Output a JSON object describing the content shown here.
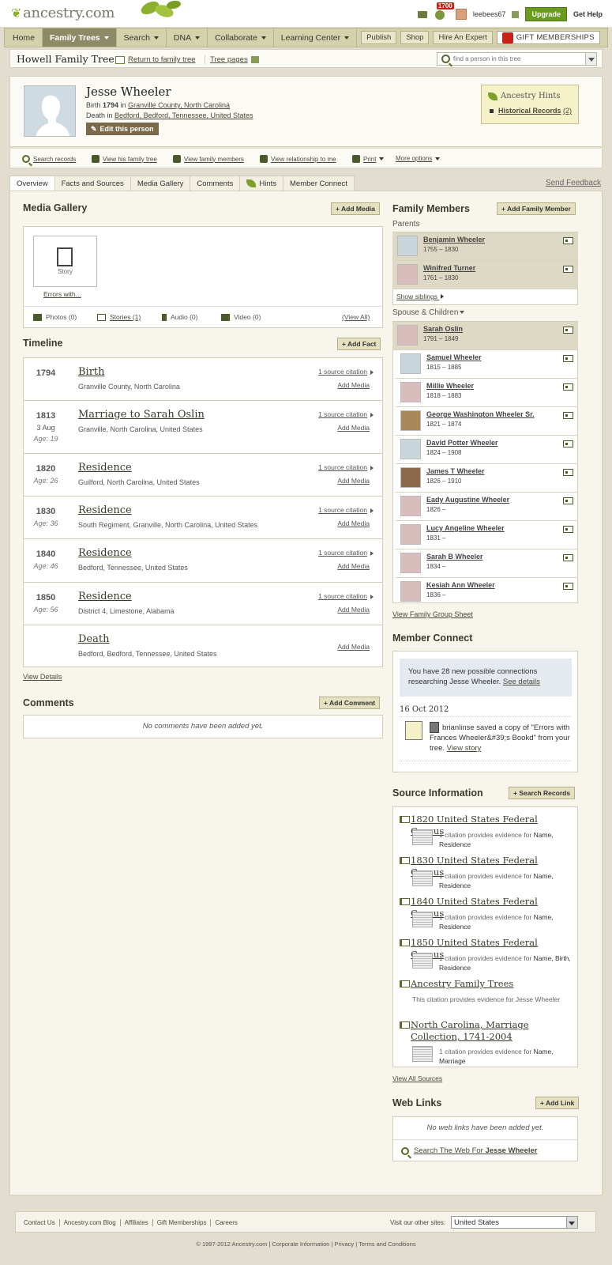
{
  "header": {
    "logo": "ancestry.com",
    "notification_count": "1700",
    "username": "leebees67",
    "upgrade": "Upgrade",
    "get_help": "Get Help"
  },
  "nav": {
    "items": [
      {
        "label": "Home",
        "dropdown": false
      },
      {
        "label": "Family Trees",
        "dropdown": true,
        "active": true
      },
      {
        "label": "Search",
        "dropdown": true
      },
      {
        "label": "DNA",
        "dropdown": true
      },
      {
        "label": "Collaborate",
        "dropdown": true
      },
      {
        "label": "Learning Center",
        "dropdown": true
      }
    ],
    "buttons": [
      "Publish",
      "Shop",
      "Hire An Expert"
    ],
    "gift": "GIFT MEMBERSHIPS"
  },
  "treebar": {
    "tree_name": "Howell Family Tree",
    "return_link": "Return to family tree",
    "tree_pages": "Tree pages",
    "find_placeholder": "find a person in this tree"
  },
  "person": {
    "name": "Jesse Wheeler",
    "birth_label": "Birth",
    "birth_year": "1794",
    "birth_in": "in",
    "birth_place": "Granville County, North Carolina",
    "death_label": "Death in",
    "death_place": "Bedford, Bedford, Tennessee, United States",
    "edit": "Edit this person"
  },
  "hints": {
    "title": "Ancestry Hints",
    "records_label": "Historical Records",
    "records_count": "(2)"
  },
  "actions": [
    "Search records",
    "View his family tree",
    "View family members",
    "View relationship to me",
    "Print",
    "More options"
  ],
  "tabs": [
    "Overview",
    "Facts and Sources",
    "Media Gallery",
    "Comments",
    "Hints",
    "Member Connect"
  ],
  "send_feedback": "Send Feedback",
  "media": {
    "title": "Media Gallery",
    "add": "+ Add Media",
    "story_label": "Story",
    "story_caption": "Errors with...",
    "photos": "Photos (0)",
    "stories": "Stories (1)",
    "audio": "Audio (0)",
    "video": "Video (0)",
    "view_all": "(View All)"
  },
  "timeline": {
    "title": "Timeline",
    "add": "+ Add Fact",
    "source": "1 source citation",
    "add_media": "Add Media",
    "events": [
      {
        "year": "1794",
        "date": "",
        "age": "",
        "event": "Birth",
        "place": "Granville County, North Carolina",
        "source": true
      },
      {
        "year": "1813",
        "date": "3 Aug",
        "age": "Age: 19",
        "event": "Marriage to Sarah Oslin",
        "place": "Granville, North Carolina, United States",
        "source": true
      },
      {
        "year": "1820",
        "date": "",
        "age": "Age: 26",
        "event": "Residence",
        "place": "Guilford, North Carolina, United States",
        "source": true
      },
      {
        "year": "1830",
        "date": "",
        "age": "Age: 36",
        "event": "Residence",
        "place": "South Regiment, Granville, North Carolina, United States",
        "source": true
      },
      {
        "year": "1840",
        "date": "",
        "age": "Age: 46",
        "event": "Residence",
        "place": "Bedford, Tennessee, United States",
        "source": true
      },
      {
        "year": "1850",
        "date": "",
        "age": "Age: 56",
        "event": "Residence",
        "place": "District 4, Limestone, Alabama",
        "source": true
      },
      {
        "year": "",
        "date": "",
        "age": "",
        "event": "Death",
        "place": "Bedford, Bedford, Tennessee, United States",
        "source": false
      }
    ],
    "view_details": "View Details"
  },
  "comments": {
    "title": "Comments",
    "add": "+ Add Comment",
    "empty": "No comments have been added yet."
  },
  "family": {
    "title": "Family Members",
    "add": "+ Add Family Member",
    "parents_label": "Parents",
    "parents": [
      {
        "name": "Benjamin Wheeler",
        "years": "1755 – 1830",
        "sex": "m"
      },
      {
        "name": "Winifred Turner",
        "years": "1761 – 1830",
        "sex": "f"
      }
    ],
    "show_siblings": "Show siblings",
    "spouse_label": "Spouse & Children",
    "spouse": {
      "name": "Sarah Oslin",
      "years": "1791 – 1849",
      "sex": "f"
    },
    "children": [
      {
        "name": "Samuel Wheeler",
        "years": "1815 – 1885",
        "sex": "m"
      },
      {
        "name": "Millie Wheeler",
        "years": "1818 – 1883",
        "sex": "f"
      },
      {
        "name": "George Washington Wheeler Sr.",
        "years": "1821 – 1874",
        "sex": "ph"
      },
      {
        "name": "David Potter Wheeler",
        "years": "1824 – 1908",
        "sex": "m"
      },
      {
        "name": "James T Wheeler",
        "years": "1826 – 1910",
        "sex": "ph2"
      },
      {
        "name": "Eady Augustine Wheeler",
        "years": "1826 –",
        "sex": "f"
      },
      {
        "name": "Lucy Angeline Wheeler",
        "years": "1831 –",
        "sex": "f"
      },
      {
        "name": "Sarah B Wheeler",
        "years": "1834 –",
        "sex": "f"
      },
      {
        "name": "Kesiah Ann Wheeler",
        "years": "1836 –",
        "sex": "f"
      }
    ],
    "group_sheet": "View Family Group Sheet"
  },
  "member_connect": {
    "title": "Member Connect",
    "message": "You have 28 new possible connections researching Jesse Wheeler.",
    "see_details": "See details",
    "date": "16 Oct 2012",
    "activity": "brianlinse saved a copy of \"Errors with Frances Wheeler&#39;s Bookd\" from your tree.",
    "view_story": "View story"
  },
  "sources": {
    "title": "Source Information",
    "add": "+ Search Records",
    "items": [
      {
        "title": "1820 United States Federal Census",
        "desc": "1 citation provides evidence for",
        "facts": "Name, Residence",
        "thumb": true
      },
      {
        "title": "1830 United States Federal Census",
        "desc": "1 citation provides evidence for",
        "facts": "Name, Residence",
        "thumb": true
      },
      {
        "title": "1840 United States Federal Census",
        "desc": "1 citation provides evidence for",
        "facts": "Name, Residence",
        "thumb": true
      },
      {
        "title": "1850 United States Federal Census",
        "desc": "1 citation provides evidence for",
        "facts": "Name, Birth, Residence",
        "thumb": true
      },
      {
        "title": "Ancestry Family Trees",
        "desc": "This citation provides evidence for Jesse Wheeler",
        "facts": "",
        "thumb": false
      },
      {
        "title": "North Carolina, Marriage Collection, 1741-2004",
        "desc": "1 citation provides evidence for",
        "facts": "Name, Marriage",
        "thumb": true
      }
    ],
    "view_all": "View All Sources"
  },
  "weblinks": {
    "title": "Web Links",
    "add": "+ Add Link",
    "empty": "No web links have been added yet.",
    "search_prefix": "Search The Web For",
    "search_name": "Jesse Wheeler"
  },
  "footer": {
    "links": [
      "Contact Us",
      "Ancestry.com Blog",
      "Affiliates",
      "Gift Memberships",
      "Careers"
    ],
    "visit_label": "Visit our other sites:",
    "country": "United States",
    "copyright": "© 1997-2012 Ancestry.com | Corporate Information | Privacy | Terms and Conditions"
  },
  "colors": {
    "accent": "#6a9a1e",
    "nav_bg": "#d4d1ad",
    "nav_active": "#8d8a68",
    "page_bg": "#e2ddce"
  }
}
